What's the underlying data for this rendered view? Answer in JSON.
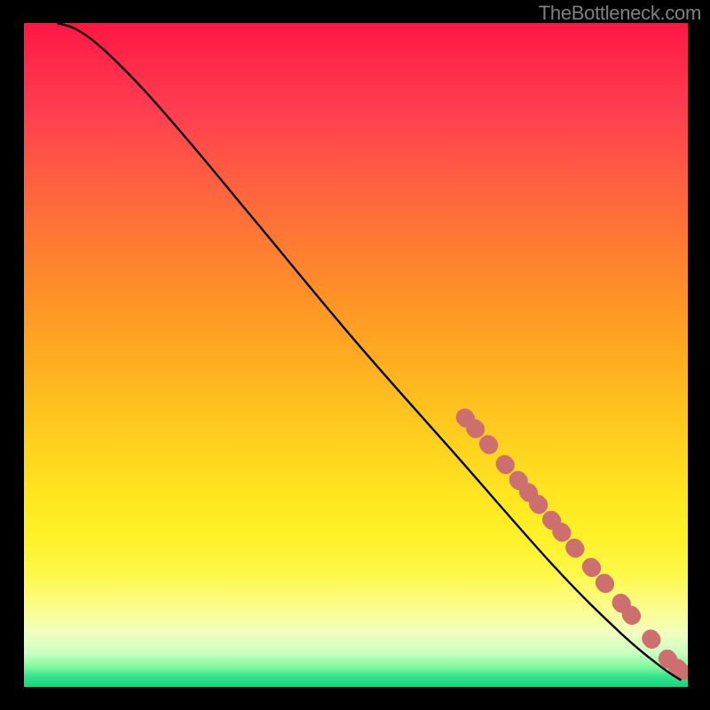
{
  "attribution": "TheBottleneck.com",
  "chart_data": {
    "type": "line",
    "title": "",
    "xlabel": "",
    "ylabel": "",
    "xlim": [
      0,
      100
    ],
    "ylim": [
      0,
      100
    ],
    "curve": {
      "description": "smooth decreasing curve from upper-left to lower-right",
      "x": [
        5,
        8,
        12,
        18,
        25,
        35,
        50,
        65,
        80,
        90,
        96,
        99
      ],
      "y": [
        100,
        99,
        96,
        90,
        82,
        70,
        52,
        35,
        18,
        8,
        3,
        1
      ]
    },
    "marked_points": {
      "type": "scatter",
      "color": "#cd6f6f",
      "radius_px": 10,
      "x": [
        66.5,
        68.0,
        70.0,
        72.5,
        74.5,
        76.0,
        77.5,
        79.5,
        81.0,
        83.0,
        85.5,
        87.5,
        90.0,
        91.5,
        94.5,
        97.0,
        98.5
      ],
      "y": [
        40.5,
        38.9,
        36.5,
        33.5,
        31.1,
        29.3,
        27.5,
        25.1,
        23.3,
        20.9,
        18.0,
        15.6,
        12.6,
        10.8,
        7.2,
        4.2,
        2.8
      ]
    }
  }
}
